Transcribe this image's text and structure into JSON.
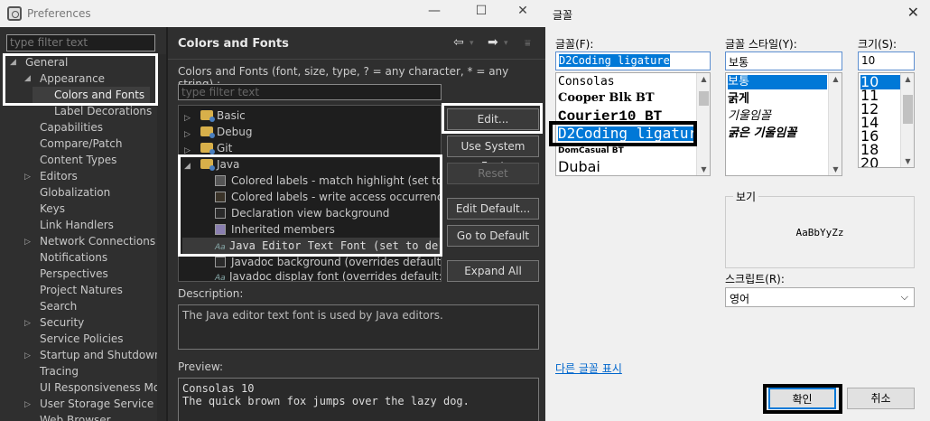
{
  "prefs": {
    "title": "Preferences",
    "filter_placeholder": "type filter text",
    "tree": [
      "General",
      "Appearance",
      "Colors and Fonts",
      "Label Decorations",
      "Capabilities",
      "Compare/Patch",
      "Content Types",
      "Editors",
      "Globalization",
      "Keys",
      "Link Handlers",
      "Network Connections",
      "Notifications",
      "Perspectives",
      "Project Natures",
      "Search",
      "Security",
      "Service Policies",
      "Startup and Shutdown",
      "Tracing",
      "UI Responsiveness Mor",
      "User Storage Service",
      "Web Browser"
    ],
    "page_title": "Colors and Fonts",
    "subtitle": "Colors and Fonts (font, size, type, ? = any character, * = any string) :",
    "filter2_placeholder": "type filter text",
    "font_tree": [
      "Basic",
      "Debug",
      "Git",
      "Java",
      "Colored labels - match highlight (set to d",
      "Colored labels - write access occurrences",
      "Declaration view background",
      "Inherited members",
      "Java Editor Text Font (set to de",
      "Javadoc background (overrides default: In",
      "Javadoc display font (overrides default: Di"
    ],
    "buttons": {
      "edit": "Edit...",
      "use_system": "Use System Font",
      "reset": "Reset",
      "edit_default": "Edit Default...",
      "go_default": "Go to Default",
      "expand_all": "Expand All"
    },
    "description_label": "Description:",
    "description": "The Java editor text font is used by Java editors.",
    "preview_label": "Preview:",
    "preview_line1": "Consolas 10",
    "preview_line2": "The quick brown fox jumps over the lazy dog."
  },
  "dialog": {
    "title": "글꼴",
    "font_label": "글꼴(F):",
    "font_value": "D2Coding ligature",
    "fonts": [
      "Consolas",
      "Cooper Blk BT",
      "Courier10 BT",
      "D2Coding ligature",
      "DomCasual BT",
      "Dubai"
    ],
    "style_label": "글꼴 스타일(Y):",
    "style_value": "보통",
    "styles": [
      "보통",
      "굵게",
      "기울임꼴",
      "굵은 기울임꼴"
    ],
    "size_label": "크기(S):",
    "size_value": "10",
    "sizes": [
      "10",
      "11",
      "12",
      "14",
      "16",
      "18",
      "20"
    ],
    "sample_label": "보기",
    "sample_text": "AaBbYyZz",
    "script_label": "스크립트(R):",
    "script_value": "영어",
    "more_fonts": "다른 글꼴 표시",
    "ok": "확인",
    "cancel": "취소"
  },
  "colors": {
    "accent": "#0078d7",
    "link": "#0066cc"
  }
}
